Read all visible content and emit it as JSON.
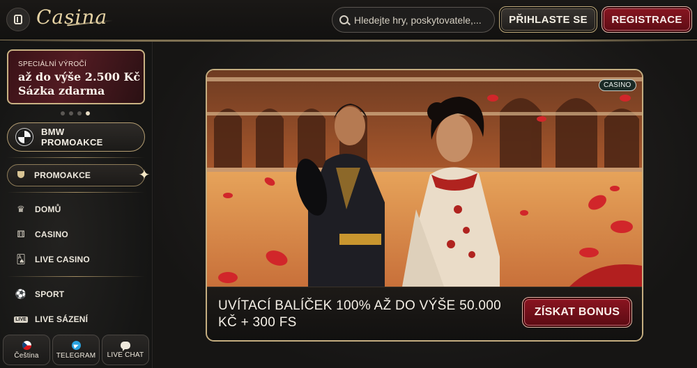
{
  "header": {
    "logo_text": "Casina",
    "search_placeholder": "Hledejte hry, poskytovatele,...",
    "login_label": "PŘIHLASTE SE",
    "register_label": "REGISTRACE"
  },
  "sidebar": {
    "promo_card": {
      "kicker": "SPECIÁLNÍ VÝROČÍ",
      "line1": "až do výše 2.500 Kč",
      "line2": "Sázka zdarma"
    },
    "carousel_dots": 4,
    "carousel_active_index": 3,
    "bmw_label_1": "BMW",
    "bmw_label_2": "PROMOAKCE",
    "promo_nav_label": "PROMOAKCE",
    "nav_items": [
      {
        "label": "DOMŮ",
        "icon": "home-crown-icon"
      },
      {
        "label": "CASINO",
        "icon": "dice-icon"
      },
      {
        "label": "LIVE CASINO",
        "icon": "cards-icon"
      },
      {
        "label": "SPORT",
        "icon": "soccer-ball-icon"
      },
      {
        "label": "LIVE SÁZENÍ",
        "icon": "live-icon",
        "tag": "LIVE"
      }
    ],
    "bottom_buttons": [
      {
        "label": "Čeština",
        "icon": "czech-flag-icon"
      },
      {
        "label": "TELEGRAM",
        "icon": "telegram-icon"
      },
      {
        "label": "LIVE CHAT",
        "icon": "chat-bubble-icon"
      }
    ]
  },
  "banner": {
    "badge": "CASINO",
    "caption": "UVÍTACÍ BALÍČEK 100% AŽ DO VÝŠE 50.000 KČ + 300 FS",
    "button_label": "ZÍSKAT BONUS"
  },
  "colors": {
    "accent_gold": "#c9b283",
    "accent_red": "#8a1621",
    "background": "#131313"
  }
}
